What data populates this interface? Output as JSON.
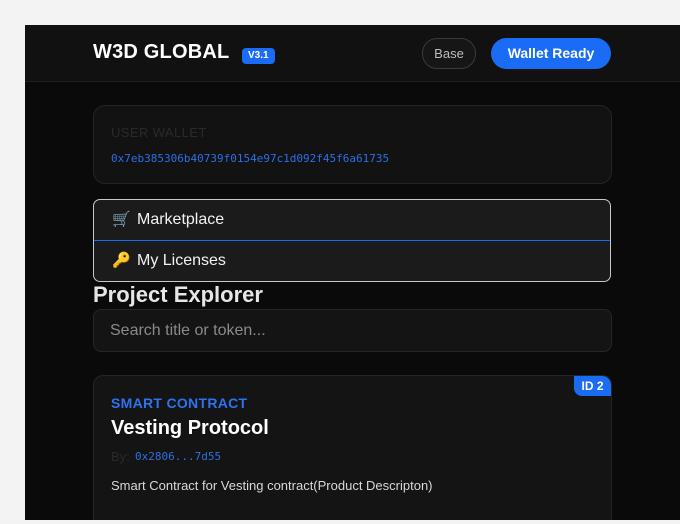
{
  "header": {
    "brand": "W3D GLOBAL",
    "version": "V3.1",
    "network_label": "Base",
    "wallet_button_label": "Wallet Ready"
  },
  "wallet": {
    "label": "USER WALLET",
    "address": "0x7eb385306b40739f0154e97c1d092f45f6a61735"
  },
  "tabs": [
    {
      "icon": "🛒",
      "icon_name": "cart-icon",
      "label": "Marketplace",
      "active": true
    },
    {
      "icon": "🔑",
      "icon_name": "key-icon",
      "label": "My Licenses",
      "active": false
    }
  ],
  "explorer": {
    "title": "Project Explorer",
    "search_placeholder": "Search title or token..."
  },
  "projects": [
    {
      "id_badge": "ID 2",
      "category": "SMART CONTRACT",
      "title": "Vesting Protocol",
      "by_label": "By:",
      "by_address": "0x2806...7d55",
      "description": "Smart Contract for Vesting contract(Product Descripton)"
    }
  ],
  "colors": {
    "accent": "#1a6cf5",
    "background": "#0a0a0a",
    "card": "#141414"
  }
}
